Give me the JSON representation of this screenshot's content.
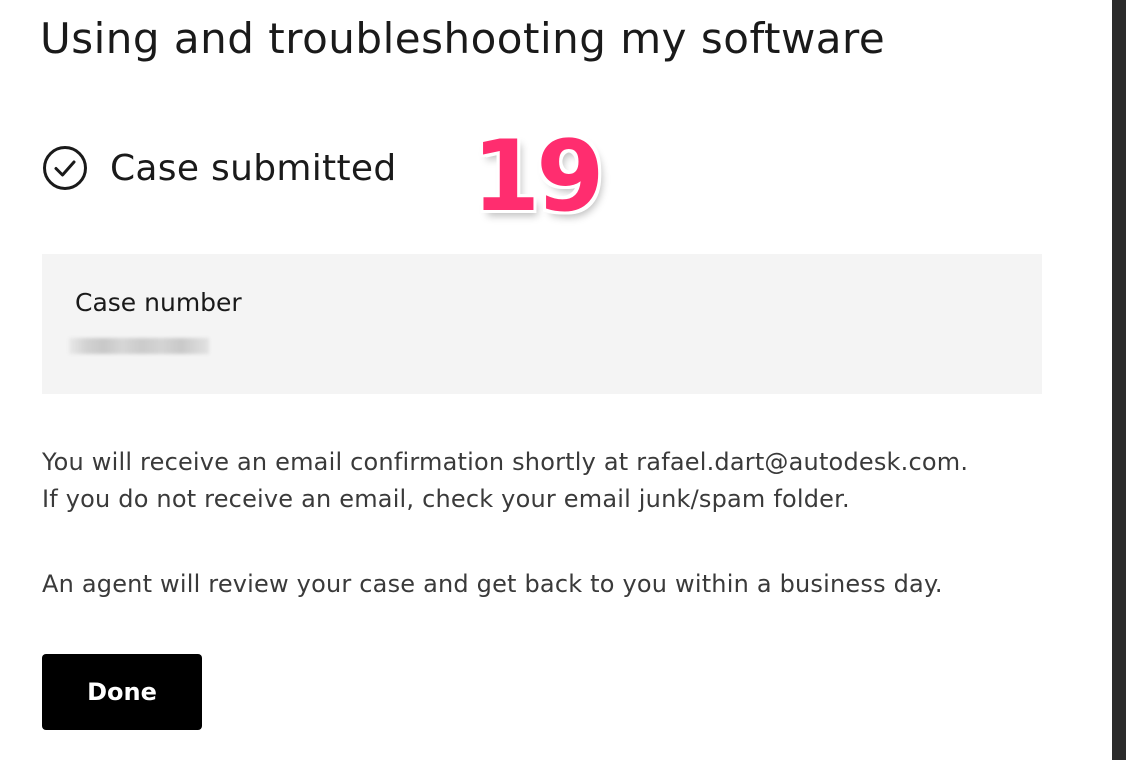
{
  "header": {
    "title": "Using and troubleshooting my software"
  },
  "status": {
    "icon": "check-circle-icon",
    "label": "Case submitted"
  },
  "annotation": {
    "step_number": "19",
    "color": "#ff2d6f"
  },
  "case": {
    "label": "Case number",
    "value_redacted": true
  },
  "messages": {
    "confirmation_line1": "You will receive an email confirmation shortly at rafael.dart@autodesk.com.",
    "confirmation_line2": "If you do not receive an email, check your email junk/spam folder.",
    "agent_notice": "An agent will review your case and get back to you within a business day."
  },
  "actions": {
    "done_label": "Done"
  }
}
